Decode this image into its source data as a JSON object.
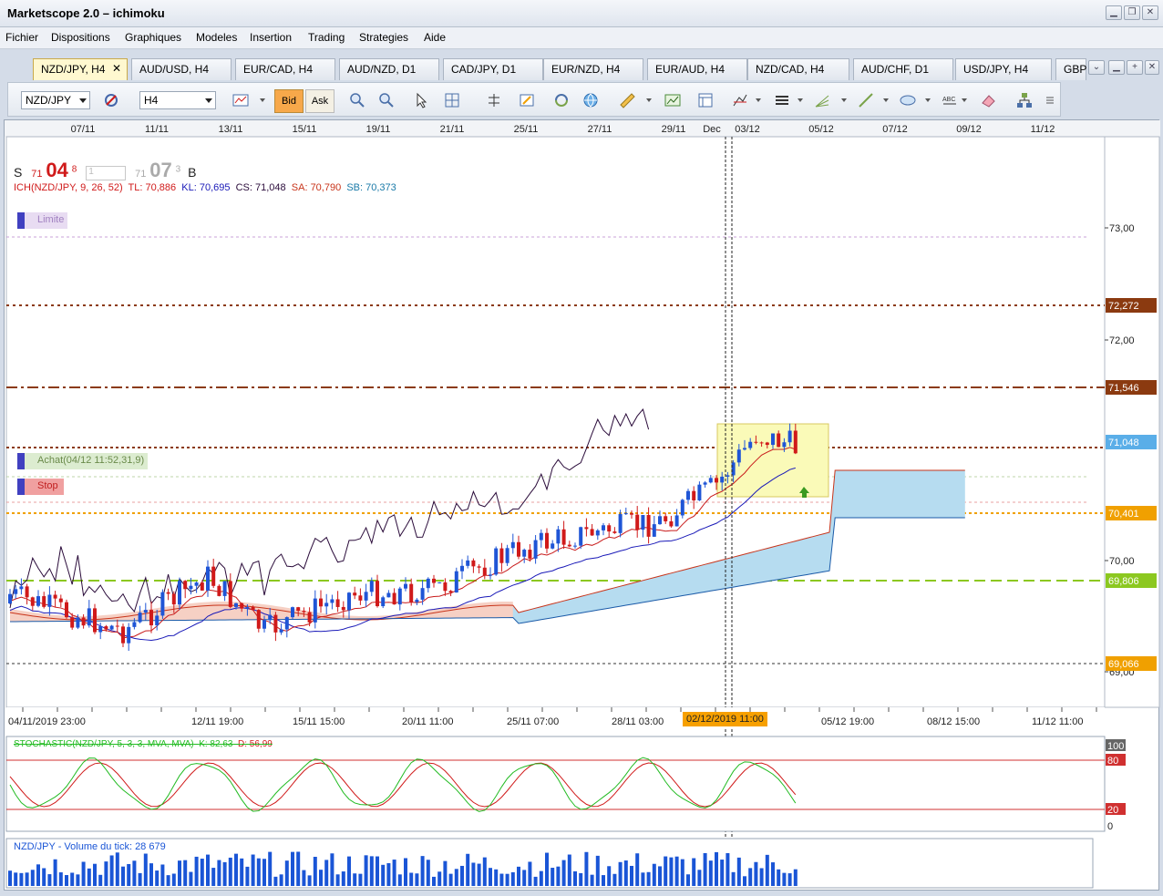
{
  "window": {
    "title": "Marketscope 2.0 – ichimoku"
  },
  "menu": [
    "Fichier",
    "Dispositions",
    "Graphiques",
    "Modeles",
    "Insertion",
    "Trading",
    "Strategies",
    "Aide"
  ],
  "tabs": [
    {
      "label": "NZD/JPY, H4",
      "active": true
    },
    {
      "label": "AUD/USD, H4"
    },
    {
      "label": "EUR/CAD, H4"
    },
    {
      "label": "AUD/NZD, D1"
    },
    {
      "label": "CAD/JPY, D1"
    },
    {
      "label": "EUR/NZD, H4"
    },
    {
      "label": "EUR/AUD, H4"
    },
    {
      "label": "NZD/CAD, H4"
    },
    {
      "label": "AUD/CHF, D1"
    },
    {
      "label": "USD/JPY, H4"
    },
    {
      "label": "GBP"
    }
  ],
  "toolbar": {
    "symbol": "NZD/JPY",
    "timeframe": "H4",
    "bid_label": "Bid",
    "ask_label": "Ask"
  },
  "quote": {
    "sell_label": "S",
    "sell_small": "71",
    "sell_big": "04",
    "sell_sup": "8",
    "amount": "1",
    "buy_small": "71",
    "buy_big": "07",
    "buy_sup": "3",
    "buy_label": "B"
  },
  "indicator": {
    "name": "ICH(NZD/JPY, 9, 26, 52)",
    "tl": "TL: 70,886",
    "kl": "KL: 70,695",
    "cs": "CS: 71,048",
    "sa": "SA: 70,790",
    "sb": "SB: 70,373"
  },
  "orders": {
    "limit": "Limite",
    "buy": "Achat(04/12 11:52,31,9)",
    "stop": "Stop"
  },
  "top_dates": [
    "07/11",
    "11/11",
    "13/11",
    "15/11",
    "19/11",
    "21/11",
    "25/11",
    "27/11",
    "29/11",
    "Dec",
    "03/12",
    "05/12",
    "07/12",
    "09/12",
    "11/12"
  ],
  "bottom_dates": [
    "04/11/2019 23:00",
    "12/11 19:00",
    "15/11 15:00",
    "20/11 11:00",
    "25/11 07:00",
    "28/11 03:00",
    "02/12/2019 11:00",
    "05/12 19:00",
    "08/12 15:00",
    "11/12 11:00"
  ],
  "price_axis": [
    "73,00",
    "72,00",
    "70,00",
    "69,00"
  ],
  "price_tags": [
    {
      "label": "72,272",
      "color": "#8b3a10"
    },
    {
      "label": "71,546",
      "color": "#8b3a10"
    },
    {
      "label": "71,048",
      "color": "#5aaee8"
    },
    {
      "label": "70,401",
      "color": "#f0a000"
    },
    {
      "label": "69,806",
      "color": "#8cc820"
    },
    {
      "label": "69,066",
      "color": "#f0a000"
    }
  ],
  "stochastic": {
    "label": "STOCHASTIC(NZD/JPY, 5, 3, 3, MVA, MVA)",
    "k": "K: 82,63",
    "d": "D: 56,99",
    "levels": [
      "100",
      "80",
      "20",
      "0"
    ]
  },
  "volume": {
    "label": "NZD/JPY - Volume du tick: 28 679"
  },
  "colors": {
    "bull": "#1f55d6",
    "bear": "#d01a1a",
    "cloud_blue": "#b6dcf0",
    "cloud_pink": "#f6d0c4",
    "highlight": "#fafab8"
  }
}
